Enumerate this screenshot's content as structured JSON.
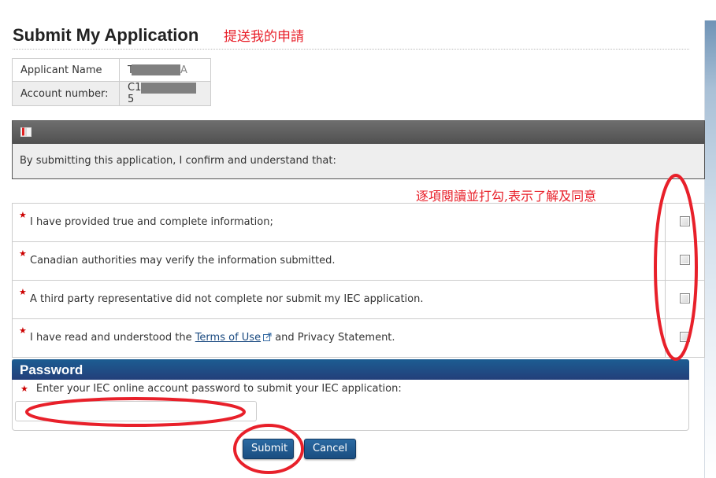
{
  "page": {
    "title": "Submit My Application",
    "title_annotation": "提送我的申請",
    "checkbox_annotation": "逐項閱讀並打勾,表示了解及同意"
  },
  "applicant": {
    "rows": [
      {
        "label": "Applicant Name",
        "value_prefix": "T",
        "value_suffix": "A",
        "redacted": true
      },
      {
        "label": "Account number:",
        "value_prefix": "C1",
        "value_suffix": "5",
        "redacted": true
      }
    ]
  },
  "confirmation": {
    "header_icon": "book-icon",
    "intro": "By submitting this application, I confirm and understand that:"
  },
  "declarations": [
    {
      "text": "I have provided true and complete information;",
      "required": true,
      "checked": false
    },
    {
      "text": "Canadian authorities may verify the information submitted.",
      "required": true,
      "checked": false
    },
    {
      "text": "A third party representative did not complete nor submit my IEC application.",
      "required": true,
      "checked": false
    },
    {
      "text_before": "I have read and understood the ",
      "link": "Terms of Use",
      "text_after": " and Privacy Statement.",
      "required": true,
      "checked": false
    }
  ],
  "password": {
    "heading": "Password",
    "label": "Enter your IEC online account password to submit your IEC application:",
    "value": ""
  },
  "buttons": {
    "submit": "Submit",
    "cancel": "Cancel"
  },
  "required_marker": "★",
  "colors": {
    "annotation": "#e8202a",
    "panel_header": "#1c5d92",
    "confirm_header": "#5a5a5a",
    "required": "#cc0000"
  }
}
